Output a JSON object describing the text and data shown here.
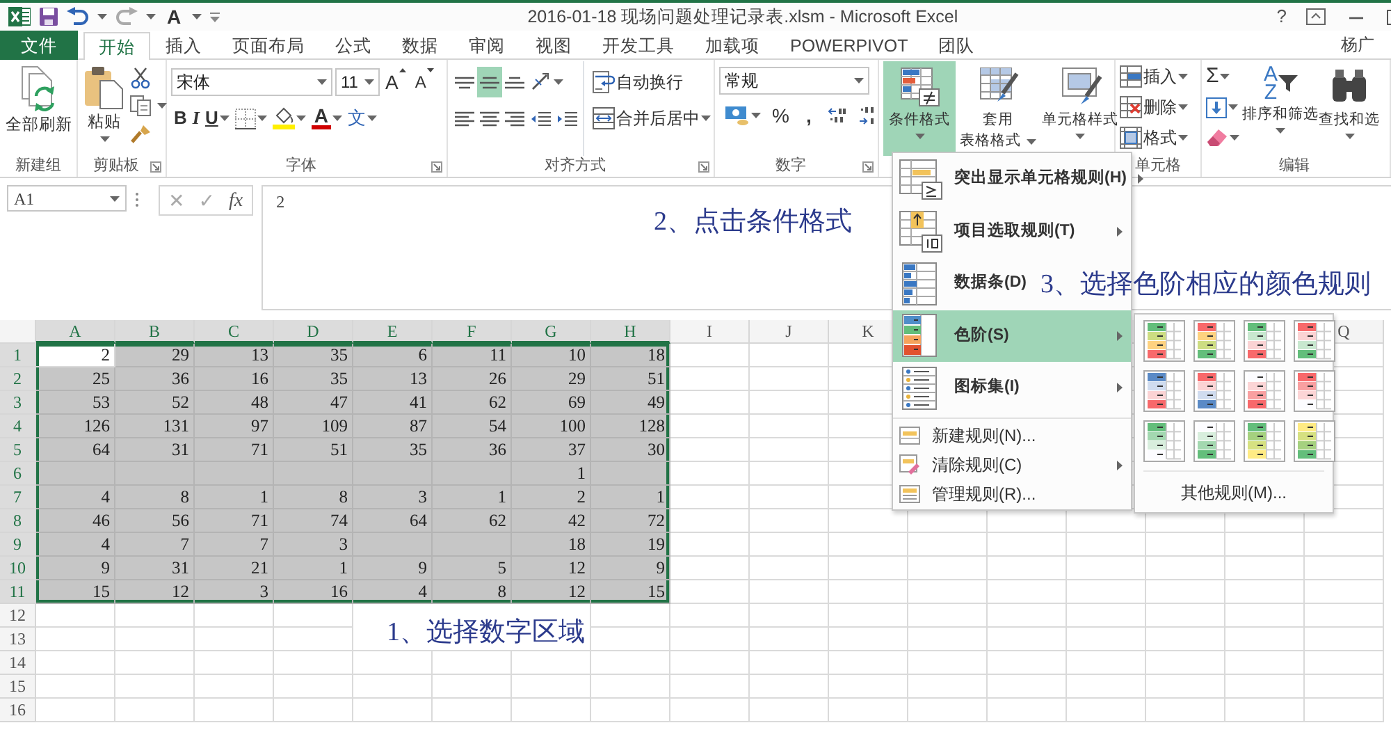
{
  "window": {
    "title": "2016-01-18 现场问题处理记录表.xlsm - Microsoft Excel",
    "help": "?",
    "user": "杨广"
  },
  "quick_access": {
    "font_color": "A"
  },
  "tabs": [
    {
      "label": "文件",
      "kind": "file",
      "selected": false
    },
    {
      "label": "开始",
      "kind": "tab",
      "selected": true
    },
    {
      "label": "插入",
      "kind": "tab",
      "selected": false
    },
    {
      "label": "页面布局",
      "kind": "tab",
      "selected": false
    },
    {
      "label": "公式",
      "kind": "tab",
      "selected": false
    },
    {
      "label": "数据",
      "kind": "tab",
      "selected": false
    },
    {
      "label": "审阅",
      "kind": "tab",
      "selected": false
    },
    {
      "label": "视图",
      "kind": "tab",
      "selected": false
    },
    {
      "label": "开发工具",
      "kind": "tab",
      "selected": false
    },
    {
      "label": "加载项",
      "kind": "tab",
      "selected": false
    },
    {
      "label": "POWERPIVOT",
      "kind": "tab",
      "selected": false
    },
    {
      "label": "团队",
      "kind": "tab",
      "selected": false
    }
  ],
  "ribbon": {
    "new_group": {
      "label": "新建组",
      "refresh_all": "全部刷新"
    },
    "clipboard": {
      "label": "剪贴板",
      "paste": "粘贴"
    },
    "font": {
      "label": "字体",
      "font_name": "宋体",
      "font_size": "11",
      "grow": "A",
      "shrink": "A",
      "bold": "B",
      "italic": "I",
      "underline": "U",
      "font_color": "A",
      "phonetic": "文"
    },
    "alignment": {
      "label": "对齐方式",
      "vertical": [
        {
          "selected": false
        },
        {
          "selected": true
        },
        {
          "selected": false
        }
      ],
      "wrap_text": "自动换行",
      "merge_center": "合并后居中"
    },
    "number": {
      "label": "数字",
      "format": "常规",
      "percent": "%",
      "comma": ","
    },
    "styles": {
      "conditional_formatting": {
        "label": "条件格式",
        "selected": true
      },
      "format_as_table": [
        "套用",
        "表格格式"
      ],
      "cell_styles": "单元格样式"
    },
    "cells": {
      "label": "单元格",
      "insert": "插入",
      "delete": "删除",
      "format": "格式"
    },
    "editing": {
      "label": "编辑",
      "autosum": "Σ",
      "sort_glyph": [
        "A",
        "Z"
      ],
      "sort_filter": "排序和筛选",
      "find_select": "查找和选"
    }
  },
  "formula_bar": {
    "name_box": "A1",
    "cancel": "✕",
    "enter": "✓",
    "fx": "fx",
    "formula": "2"
  },
  "sheet": {
    "columns": [
      {
        "label": "A",
        "selected": true
      },
      {
        "label": "B",
        "selected": true
      },
      {
        "label": "C",
        "selected": true
      },
      {
        "label": "D",
        "selected": true
      },
      {
        "label": "E",
        "selected": true
      },
      {
        "label": "F",
        "selected": true
      },
      {
        "label": "G",
        "selected": true
      },
      {
        "label": "H",
        "selected": true
      },
      {
        "label": "I",
        "selected": false
      },
      {
        "label": "J",
        "selected": false
      },
      {
        "label": "K",
        "selected": false
      },
      {
        "label": "Q",
        "selected": false,
        "gap_before": true
      }
    ],
    "rows": [
      {
        "label": "1",
        "selected": true,
        "cells": [
          "2",
          "29",
          "13",
          "35",
          "6",
          "11",
          "10",
          "18"
        ]
      },
      {
        "label": "2",
        "selected": true,
        "cells": [
          "25",
          "36",
          "16",
          "35",
          "13",
          "26",
          "29",
          "51"
        ]
      },
      {
        "label": "3",
        "selected": true,
        "cells": [
          "53",
          "52",
          "48",
          "47",
          "41",
          "62",
          "69",
          "49"
        ]
      },
      {
        "label": "4",
        "selected": true,
        "cells": [
          "126",
          "131",
          "97",
          "109",
          "87",
          "54",
          "100",
          "128"
        ]
      },
      {
        "label": "5",
        "selected": true,
        "cells": [
          "64",
          "31",
          "71",
          "51",
          "35",
          "36",
          "37",
          "30"
        ]
      },
      {
        "label": "6",
        "selected": true,
        "cells": [
          null,
          null,
          null,
          null,
          null,
          null,
          "1",
          null
        ]
      },
      {
        "label": "7",
        "selected": true,
        "cells": [
          "4",
          "8",
          "1",
          "8",
          "3",
          "1",
          "2",
          "1"
        ]
      },
      {
        "label": "8",
        "selected": true,
        "cells": [
          "46",
          "56",
          "71",
          "74",
          "64",
          "62",
          "42",
          "72"
        ]
      },
      {
        "label": "9",
        "selected": true,
        "cells": [
          "4",
          "7",
          "7",
          "3",
          null,
          null,
          "18",
          "19"
        ]
      },
      {
        "label": "10",
        "selected": true,
        "cells": [
          "9",
          "31",
          "21",
          "1",
          "9",
          "5",
          "12",
          "9"
        ]
      },
      {
        "label": "11",
        "selected": true,
        "cells": [
          "15",
          "12",
          "3",
          "16",
          "4",
          "8",
          "12",
          "15"
        ]
      },
      {
        "label": "12",
        "selected": false
      },
      {
        "label": "13",
        "selected": false
      },
      {
        "label": "14",
        "selected": false
      },
      {
        "label": "15",
        "selected": false
      },
      {
        "label": "16",
        "selected": false
      }
    ]
  },
  "conditional_menu": {
    "items": [
      {
        "label": "突出显示单元格规则(H)",
        "kind": "highlight",
        "submenu": true,
        "selected": false
      },
      {
        "label": "项目选取规则(T)",
        "kind": "topbottom",
        "submenu": true,
        "selected": false
      },
      {
        "label": "数据条(D)",
        "kind": "databar",
        "submenu": false,
        "selected": false
      },
      {
        "label": "色阶(S)",
        "kind": "colorscale",
        "submenu": true,
        "selected": true
      },
      {
        "label": "图标集(I)",
        "kind": "iconset",
        "submenu": true,
        "selected": false
      },
      {
        "label": "新建规则(N)...",
        "kind": "new",
        "submenu": false,
        "selected": false
      },
      {
        "label": "清除规则(C)",
        "kind": "clear",
        "submenu": true,
        "selected": false
      },
      {
        "label": "管理规则(R)...",
        "kind": "manage",
        "submenu": false,
        "selected": false
      }
    ]
  },
  "color_scale_menu": {
    "more_rules": "其他规则(M)..."
  },
  "annotations": [
    {
      "text": "2、点击条件格式"
    },
    {
      "text": "3、选择色阶相应的颜色规则"
    },
    {
      "text": "1、选择数字区域"
    }
  ]
}
